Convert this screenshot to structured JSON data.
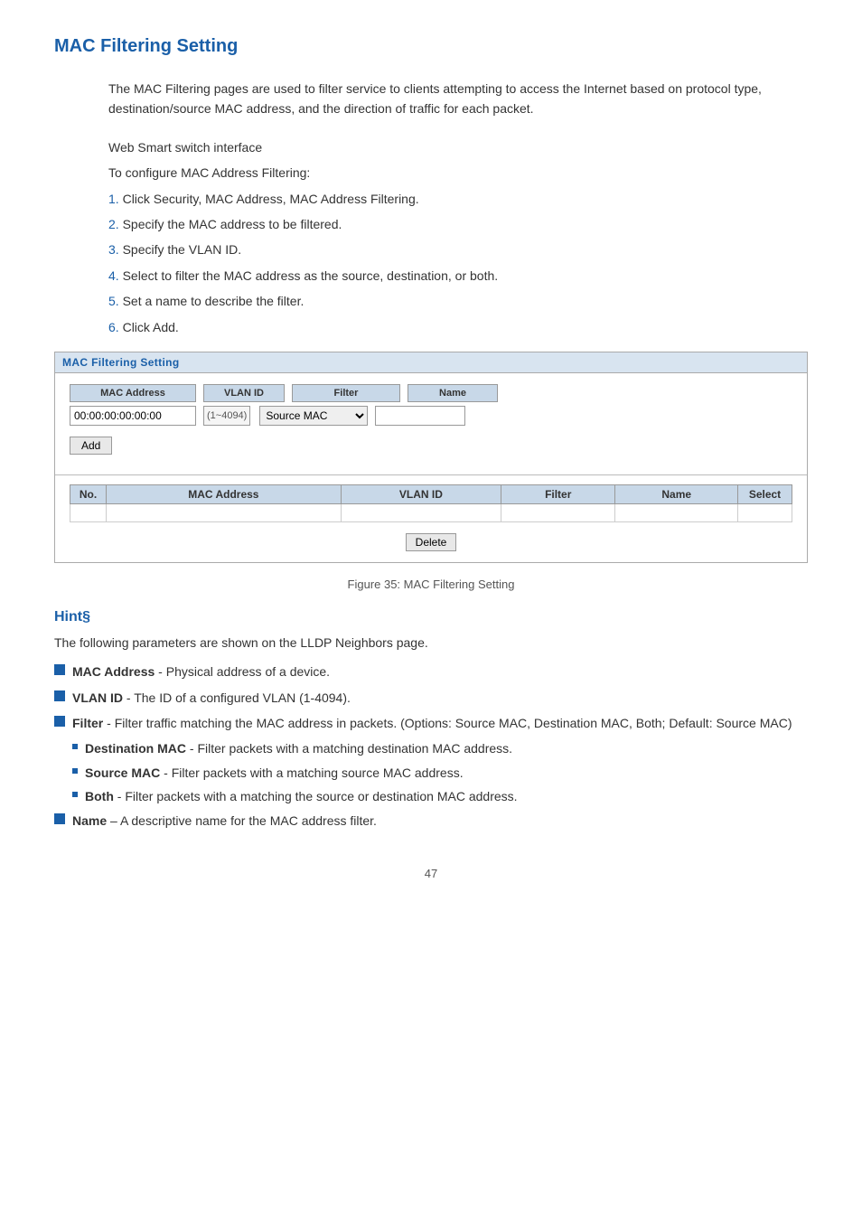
{
  "page": {
    "title": "MAC Filtering Setting",
    "intro": "The MAC Filtering pages are used to filter service to clients attempting to access the Internet based on protocol type, destination/source MAC address, and the direction of traffic for each packet.",
    "context_label": "Web Smart switch interface",
    "configure_label": "To configure MAC Address Filtering:",
    "steps": [
      {
        "number": "1.",
        "text": "Click Security, MAC Address, MAC Address Filtering."
      },
      {
        "number": "2.",
        "text": "Specify the MAC address to be filtered."
      },
      {
        "number": "3.",
        "text": "Specify the VLAN ID."
      },
      {
        "number": "4.",
        "text": "Select to filter the MAC address as the source, destination, or both."
      },
      {
        "number": "5.",
        "text": "Set a name to describe the filter."
      },
      {
        "number": "6.",
        "text": "Click Add."
      }
    ],
    "widget": {
      "title": "MAC Filtering Setting",
      "form": {
        "mac_address_header": "MAC Address",
        "vlan_id_header": "VLAN ID",
        "filter_header": "Filter",
        "name_header": "Name",
        "mac_address_value": "00:00:00:00:00:00",
        "vlan_range": "(1~4094)",
        "filter_default": "Source MAC",
        "filter_options": [
          "Source MAC",
          "Destination MAC",
          "Both"
        ],
        "name_value": "",
        "add_button": "Add"
      },
      "table": {
        "columns": [
          "No.",
          "MAC Address",
          "VLAN ID",
          "Filter",
          "Name",
          "Select"
        ],
        "rows": [],
        "delete_button": "Delete"
      }
    },
    "figure_caption": "Figure 35: MAC Filtering Setting",
    "hint": {
      "title": "Hint§",
      "intro": "The following parameters are shown on the LLDP Neighbors page.",
      "items": [
        {
          "label": "MAC Address",
          "sep": " - ",
          "text": "Physical address of a device."
        },
        {
          "label": "VLAN ID",
          "sep": " - ",
          "text": "The ID of a configured VLAN (1-4094)."
        },
        {
          "label": "Filter",
          "sep": " - ",
          "text": "Filter traffic matching the MAC address in packets. (Options: Source MAC, Destination MAC, Both; Default: Source MAC)"
        },
        {
          "label": "Name",
          "sep": " – ",
          "text": "A descriptive name for the MAC address filter."
        }
      ],
      "sub_items": [
        {
          "label": "Destination MAC",
          "sep": " - ",
          "text": "Filter packets with a matching destination MAC address."
        },
        {
          "label": "Source MAC",
          "sep": " - ",
          "text": "Filter packets with a matching source MAC address."
        },
        {
          "label": "Both",
          "sep": " - ",
          "text": "Filter packets with a matching the source or destination MAC address."
        }
      ]
    },
    "page_number": "47"
  }
}
